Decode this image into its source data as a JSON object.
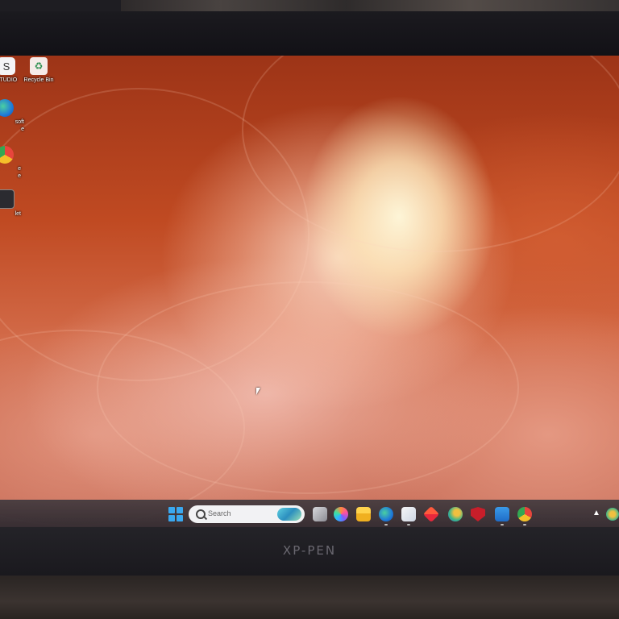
{
  "desktop": {
    "icons": [
      {
        "label": "STUDIO",
        "icon": "xppen-studio-icon"
      },
      {
        "label": "Recycle Bin",
        "icon": "recycle-bin-icon"
      },
      {
        "label": "soft\ne",
        "icon": "edge-icon"
      },
      {
        "label": "e\ne",
        "icon": "chrome-icon"
      },
      {
        "label": "let",
        "icon": "tablet-app-icon"
      }
    ]
  },
  "taskbar": {
    "search_placeholder": "Search",
    "apps": [
      "task-view-icon",
      "copilot-icon",
      "file-explorer-icon",
      "edge-icon",
      "store-icon",
      "office-icon",
      "chat-icon",
      "mcafee-icon",
      "mail-icon",
      "chrome-icon"
    ]
  },
  "monitor": {
    "brand": "XP-PEN"
  },
  "colors": {
    "taskbar": "#3a3338",
    "accent_blue": "#3aa8f0",
    "wallpaper_deep": "#b3401e",
    "wallpaper_light": "#fff4dc"
  }
}
